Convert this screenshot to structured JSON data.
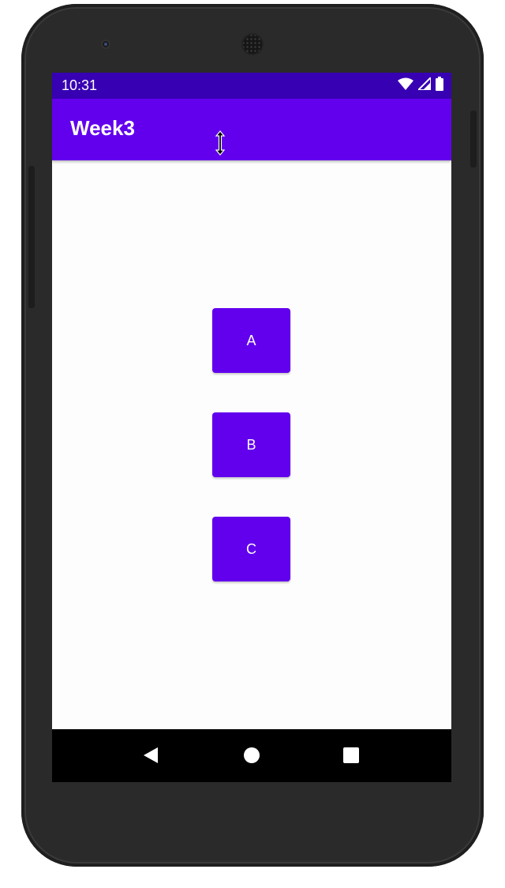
{
  "status_bar": {
    "time": "10:31",
    "icons": [
      "wifi-icon",
      "cell-signal-icon",
      "battery-icon"
    ],
    "color": "#3700b3"
  },
  "app_bar": {
    "title": "Week3",
    "color": "#6200ee"
  },
  "buttons": {
    "a_label": "A",
    "b_label": "B",
    "c_label": "C",
    "color": "#6200ee"
  },
  "nav_bar": {
    "icons": [
      "back-icon",
      "home-icon",
      "recents-icon"
    ]
  }
}
